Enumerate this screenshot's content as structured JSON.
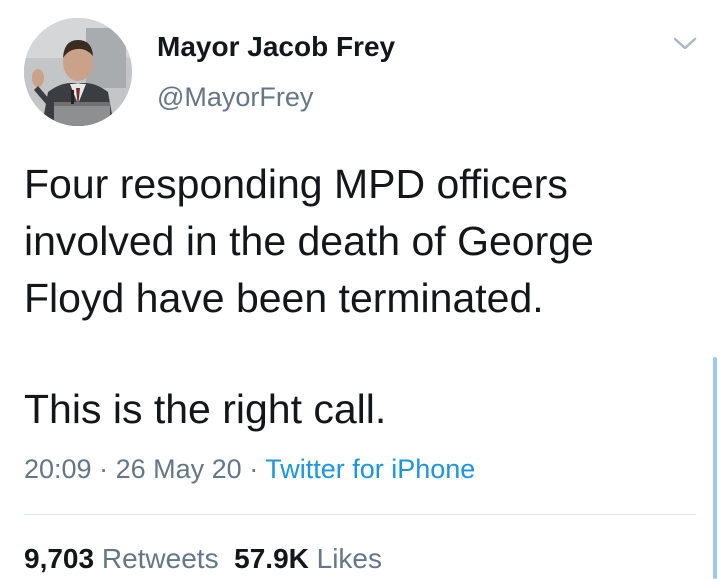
{
  "account": {
    "display_name": "Mayor Jacob Frey",
    "handle": "@MayorFrey"
  },
  "tweet": {
    "text_lines": [
      "Four responding MPD officers",
      "involved in the death of George",
      "Floyd have been terminated."
    ],
    "text_line_2": "This is the right call.",
    "time": "20:09",
    "date": "26 May 20",
    "separator": "·",
    "source": "Twitter for iPhone"
  },
  "stats": {
    "retweets_count": "9,703",
    "retweets_label": "Retweets",
    "likes_count": "57.9K",
    "likes_label": "Likes"
  },
  "icons": {
    "menu": "chevron-down-icon"
  },
  "colors": {
    "text": "#14171a",
    "secondary": "#657786",
    "link": "#1b95e0",
    "divider": "#e1e8ed"
  }
}
